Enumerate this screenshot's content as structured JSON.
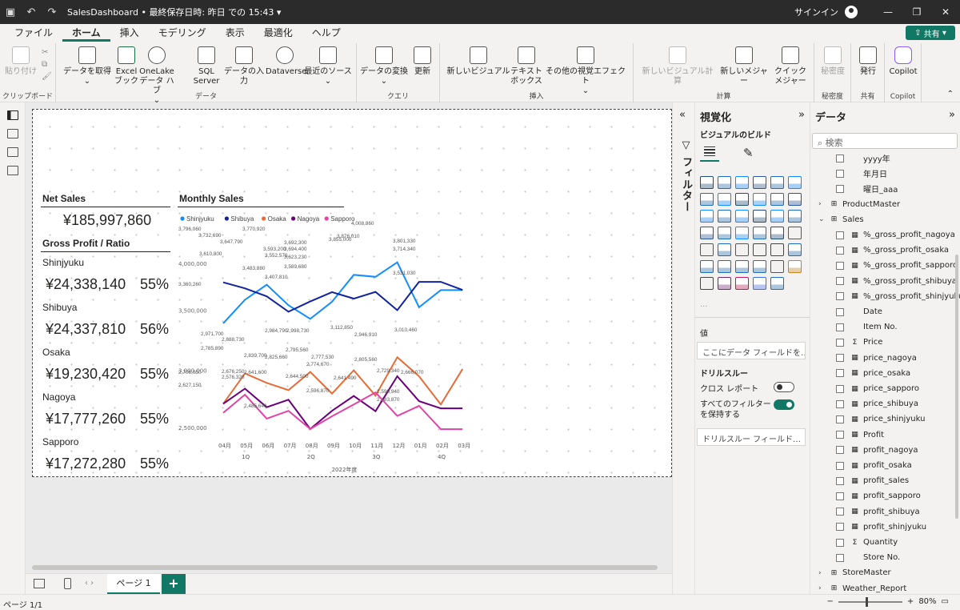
{
  "titlebar": {
    "title": "SalesDashboard • 最終保存日時: 昨日 での 15:43 ▾",
    "signin": "サインイン"
  },
  "tabs": [
    "ファイル",
    "ホーム",
    "挿入",
    "モデリング",
    "表示",
    "最適化",
    "ヘルプ"
  ],
  "share": "共有",
  "ribbon": {
    "clipboard": {
      "paste": "貼り付け",
      "label": "クリップボード"
    },
    "data": {
      "get": "データを取得",
      "excel": "Excel ブック",
      "onelake": "OneLake データ ハブ",
      "sql": "SQL Server",
      "enter": "データの入力",
      "dataverse": "Dataverse",
      "recent": "最近のソース",
      "label": "データ"
    },
    "query": {
      "transform": "データの変換",
      "refresh": "更新",
      "label": "クエリ"
    },
    "insert": {
      "newvisual": "新しいビジュアル",
      "textbox": "テキスト ボックス",
      "more": "その他の視覚エフェクト",
      "label": "挿入"
    },
    "calc": {
      "newcalc": "新しいビジュアル計算",
      "newmeasure": "新しいメジャー",
      "quick": "クイック メジャー",
      "label": "計算"
    },
    "sens": {
      "btn": "秘密度",
      "label": "秘密度"
    },
    "share": {
      "publish": "発行",
      "label": "共有"
    },
    "copilot": {
      "btn": "Copilot",
      "label": "Copilot"
    }
  },
  "report": {
    "net_sales_title": "Net Sales",
    "net_sales_value": "¥185,997,860",
    "gp_title": "Gross Profit /  Ratio",
    "stores": [
      {
        "name": "Shinjyuku",
        "value": "¥24,338,140",
        "ratio": "55%"
      },
      {
        "name": "Shibuya",
        "value": "¥24,337,810",
        "ratio": "56%"
      },
      {
        "name": "Osaka",
        "value": "¥19,230,420",
        "ratio": "55%"
      },
      {
        "name": "Nagoya",
        "value": "¥17,777,260",
        "ratio": "55%"
      },
      {
        "name": "Sapporo",
        "value": "¥17,272,280",
        "ratio": "55%"
      }
    ],
    "monthly_title": "Monthly Sales"
  },
  "chart_data": {
    "type": "line",
    "title": "Monthly Sales",
    "categories": [
      "04月",
      "05月",
      "06月",
      "07月",
      "08月",
      "09月",
      "10月",
      "11月",
      "12月",
      "01月",
      "02月",
      "03月"
    ],
    "quarters": [
      "1Q",
      "2Q",
      "3Q",
      "4Q"
    ],
    "xlabel": "2022年度",
    "y_ticks_upper": [
      "4,000,000",
      "3,500,000"
    ],
    "y_ticks_lower": [
      "3,000,000",
      "2,500,000"
    ],
    "series": [
      {
        "name": "Shinjyuku",
        "color": "#118dff",
        "values": [
          3360260,
          3610800,
          3770920,
          3552570,
          3407810,
          3589680,
          3876010,
          3855000,
          4008860,
          3531030,
          3714340,
          3714340
        ]
      },
      {
        "name": "Shibuya",
        "color": "#12239e",
        "values": [
          3796060,
          3732690,
          3647790,
          3483880,
          3593200,
          3692300,
          3623230,
          3694400,
          3500000,
          3801330,
          3801330,
          3715000
        ]
      },
      {
        "name": "Osaka",
        "color": "#e66c37",
        "values": [
          2706050,
          2971700,
          2888730,
          2825660,
          2984790,
          2795560,
          2998730,
          2777530,
          3112850,
          2946910,
          2700000,
          3010460
        ]
      },
      {
        "name": "Nagoya",
        "color": "#6b007b",
        "values": [
          2706050,
          2838700,
          2676250,
          2741600,
          2485640,
          2644500,
          2774670,
          2641490,
          2946910,
          2729340,
          2666070,
          2666070
        ]
      },
      {
        "name": "Sapporo",
        "color": "#e044a7",
        "values": [
          2627150,
          2785890,
          2576320,
          2644500,
          2485640,
          2596870,
          2700000,
          2805560,
          2599940,
          2688000,
          2483870,
          2483870
        ]
      }
    ],
    "data_labels_shown": [
      "3,796,060",
      "3,732,690",
      "3,647,790",
      "3,610,800",
      "3,770,920",
      "3,483,880",
      "3,552,570",
      "3,593,200",
      "3,407,810",
      "3,692,300",
      "3,694,400",
      "3,623,230",
      "3,589,680",
      "3,876,010",
      "3,855,000",
      "4,008,860",
      "3,801,330",
      "3,714,340",
      "3,531,030",
      "3,360,260",
      "2,971,700",
      "2,888,730",
      "2,785,890",
      "2,839,700",
      "2,984,790",
      "2,998,730",
      "3,112,850",
      "2,946,910",
      "3,010,460",
      "2,825,660",
      "2,795,560",
      "2,777,530",
      "2,774,670",
      "2,805,560",
      "2,729,340",
      "2,666,070",
      "2,706,050",
      "2,627,150",
      "2,576,320",
      "2,641,600",
      "2,676,250",
      "2,485,640",
      "2,644,500",
      "2,596,870",
      "2,641,490",
      "2,599,940",
      "2,483,870"
    ]
  },
  "vizpane": {
    "title": "視覚化",
    "build": "ビジュアルのビルド",
    "values": "値",
    "values_well": "ここにデータ フィールドを…",
    "drill_title": "ドリルスルー",
    "cross": "クロス レポート",
    "keep": "すべてのフィルターを保持する",
    "drill_well": "ドリルスルー フィールド…"
  },
  "filters": "フィルター",
  "datapane": {
    "title": "データ",
    "search": "検索",
    "items": [
      {
        "text": "yyyy年",
        "type": "field"
      },
      {
        "text": "年月日",
        "type": "field"
      },
      {
        "text": "曜日_aaa",
        "type": "field"
      },
      {
        "text": "ProductMaster",
        "type": "table"
      },
      {
        "text": "Sales",
        "type": "table-open"
      },
      {
        "text": "%_gross_profit_nagoya",
        "type": "measure"
      },
      {
        "text": "%_gross_profit_osaka",
        "type": "measure"
      },
      {
        "text": "%_gross_profit_sapporo",
        "type": "measure"
      },
      {
        "text": "%_gross_profit_shibuya",
        "type": "measure"
      },
      {
        "text": "%_gross_profit_shinjyuku",
        "type": "measure"
      },
      {
        "text": "Date",
        "type": "field"
      },
      {
        "text": "Item No.",
        "type": "field"
      },
      {
        "text": "Price",
        "type": "sum"
      },
      {
        "text": "price_nagoya",
        "type": "measure"
      },
      {
        "text": "price_osaka",
        "type": "measure"
      },
      {
        "text": "price_sapporo",
        "type": "measure"
      },
      {
        "text": "price_shibuya",
        "type": "measure"
      },
      {
        "text": "price_shinjyuku",
        "type": "measure"
      },
      {
        "text": "Profit",
        "type": "measure"
      },
      {
        "text": "profit_nagoya",
        "type": "measure"
      },
      {
        "text": "profit_osaka",
        "type": "measure"
      },
      {
        "text": "profit_sales",
        "type": "measure"
      },
      {
        "text": "profit_sapporo",
        "type": "measure"
      },
      {
        "text": "profit_shibuya",
        "type": "measure"
      },
      {
        "text": "profit_shinjyuku",
        "type": "measure"
      },
      {
        "text": "Quantity",
        "type": "sum"
      },
      {
        "text": "Store No.",
        "type": "field"
      },
      {
        "text": "StoreMaster",
        "type": "table"
      },
      {
        "text": "Weather_Report",
        "type": "table"
      }
    ]
  },
  "pagebar": {
    "tab": "ページ 1"
  },
  "status": {
    "page": "ページ 1/1",
    "zoom": "80%"
  }
}
